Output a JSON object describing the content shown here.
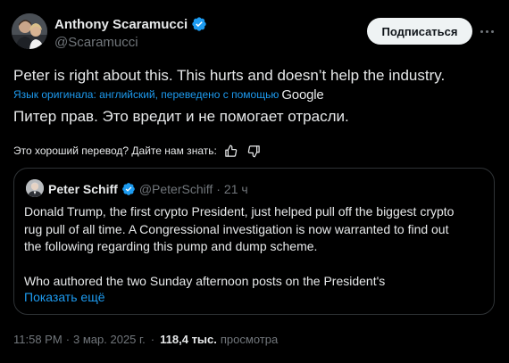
{
  "author": {
    "name": "Anthony Scaramucci",
    "handle": "@Scaramucci"
  },
  "actions": {
    "subscribe_label": "Подписаться"
  },
  "tweet": {
    "text_original": "Peter is right about this. This hurts and doesn’t help the industry.",
    "translation_note": "Язык оригинала: английский, переведено с помощью",
    "translation_provider": "Google",
    "text_translated": "Питер прав. Это вредит и не помогает отрасли.",
    "feedback_prompt": "Это хороший перевод? Дайте нам знать:"
  },
  "quote": {
    "name": "Peter Schiff",
    "handle": "@PeterSchiff",
    "dot": "·",
    "time": "21 ч",
    "lines": [
      "Donald Trump, the first crypto President, just helped pull off the biggest crypto",
      "rug pull of all time. A Congressional investigation is now warranted to find out",
      "the following regarding this pump and dump scheme."
    ],
    "line_after_gap": "Who authored the two Sunday afternoon posts on the President's",
    "show_more": "Показать ещё"
  },
  "meta": {
    "time": "11:58 PM",
    "sep": "·",
    "date": "3 мар. 2025 г.",
    "views_count": "118,4 тыс.",
    "views_label": "просмотра"
  },
  "colors": {
    "background": "#000000",
    "text": "#e7e9ea",
    "secondary": "#71767b",
    "link": "#1d9bf0",
    "verified": "#1d9bf0",
    "border": "#2f3336"
  }
}
